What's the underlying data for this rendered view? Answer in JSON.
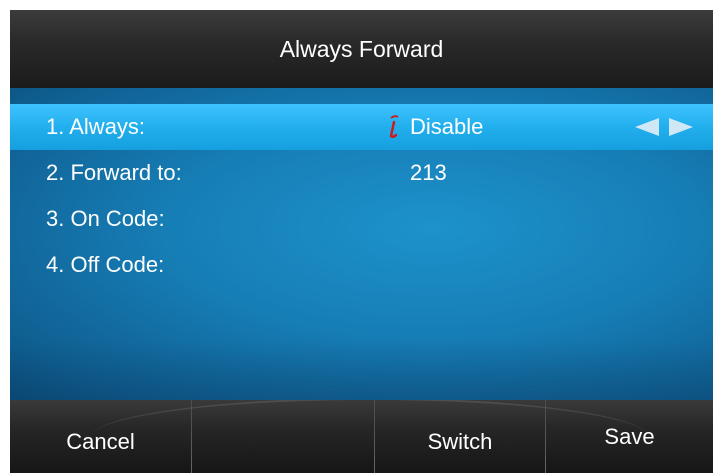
{
  "header": {
    "title": "Always Forward"
  },
  "rows": [
    {
      "label": "1. Always:",
      "value": "Disable",
      "selected": true
    },
    {
      "label": "2. Forward to:",
      "value": "213",
      "selected": false
    },
    {
      "label": "3. On Code:",
      "value": "",
      "selected": false
    },
    {
      "label": "4. Off Code:",
      "value": "",
      "selected": false
    }
  ],
  "icons": {
    "input_cursor": "text-input-cursor-icon",
    "left_arrow": "left-arrow-icon",
    "right_arrow": "right-arrow-icon"
  },
  "softkeys": {
    "cancel": "Cancel",
    "empty": "",
    "switch": "Switch",
    "save": "Save"
  },
  "colors": {
    "selected_row": "#22afed",
    "background": "#167db5",
    "cursor_icon": "#d01818",
    "bar": "#262626"
  }
}
